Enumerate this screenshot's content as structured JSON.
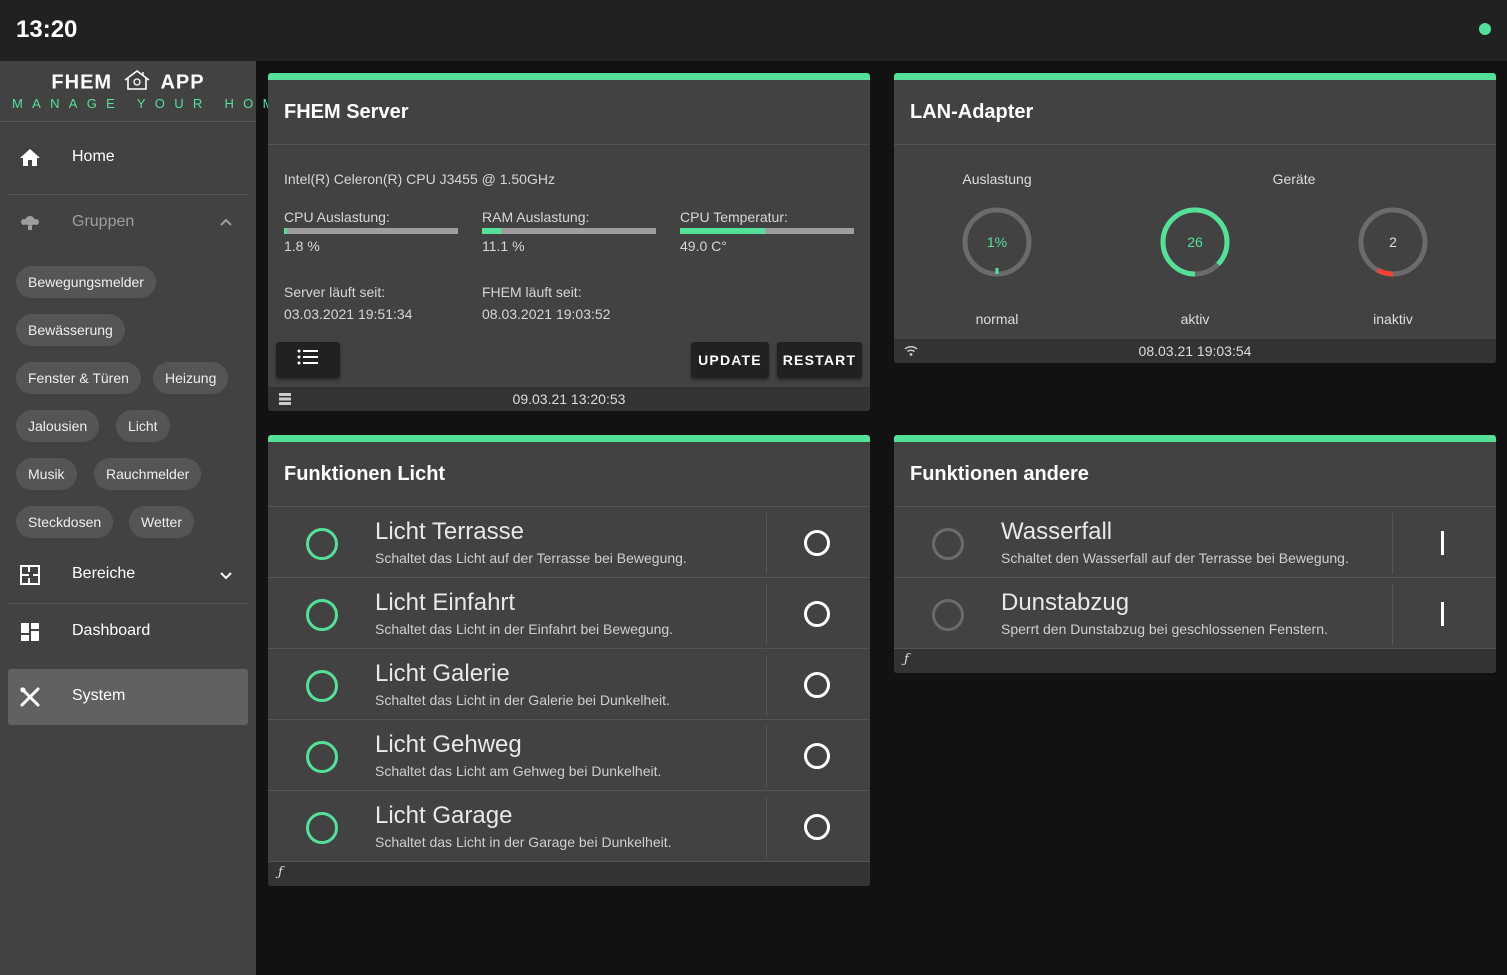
{
  "topbar": {
    "time": "13:20",
    "status_color": "#55e09a"
  },
  "brand": {
    "left": "FHEM",
    "right": "APP",
    "subtitle": "MANAGE YOUR HOME"
  },
  "nav": {
    "home": "Home",
    "gruppen": "Gruppen",
    "bereiche": "Bereiche",
    "dashboard": "Dashboard",
    "system": "System"
  },
  "chips": [
    "Bewegungsmelder",
    "Bewässerung",
    "Fenster & Türen",
    "Heizung",
    "Jalousien",
    "Licht",
    "Musik",
    "Rauchmelder",
    "Steckdosen",
    "Wetter"
  ],
  "server": {
    "title": "FHEM Server",
    "cpu_model": "Intel(R) Celeron(R) CPU J3455 @ 1.50GHz",
    "cpu_label": "CPU Auslastung:",
    "cpu_value": "1.8 %",
    "cpu_percent": 1.8,
    "ram_label": "RAM Auslastung:",
    "ram_value": "11.1 %",
    "ram_percent": 11.1,
    "temp_label": "CPU Temperatur:",
    "temp_value": "49.0 C°",
    "temp_percent": 49,
    "uptime_label": "Server läuft seit:",
    "uptime_value": "03.03.2021 19:51:34",
    "fhem_label": "FHEM läuft seit:",
    "fhem_value": "08.03.2021 19:03:52",
    "update_btn": "UPDATE",
    "restart_btn": "RESTART",
    "footer_time": "09.03.21 13:20:53"
  },
  "lan": {
    "title": "LAN-Adapter",
    "col1_label": "Auslastung",
    "col2_label": "Geräte",
    "gauge1_value": "1%",
    "gauge1_caption": "normal",
    "gauge2_value": "26",
    "gauge2_caption": "aktiv",
    "gauge3_value": "2",
    "gauge3_caption": "inaktiv",
    "footer_time": "08.03.21 19:03:54"
  },
  "licht": {
    "title": "Funktionen Licht",
    "footer_symbol": "ƒ",
    "items": [
      {
        "title": "Licht Terrasse",
        "desc": "Schaltet das Licht auf der Terrasse bei Bewegung."
      },
      {
        "title": "Licht Einfahrt",
        "desc": "Schaltet das Licht in der Einfahrt bei Bewegung."
      },
      {
        "title": "Licht Galerie",
        "desc": "Schaltet das Licht in der Galerie bei Dunkelheit."
      },
      {
        "title": "Licht Gehweg",
        "desc": "Schaltet das Licht am Gehweg bei Dunkelheit."
      },
      {
        "title": "Licht Garage",
        "desc": "Schaltet das Licht in der Garage bei Dunkelheit."
      }
    ]
  },
  "andere": {
    "title": "Funktionen andere",
    "footer_symbol": "ƒ",
    "items": [
      {
        "title": "Wasserfall",
        "desc": "Schaltet den Wasserfall auf der Terrasse bei Bewegung."
      },
      {
        "title": "Dunstabzug",
        "desc": "Sperrt den Dunstabzug bei geschlossenen Fenstern."
      }
    ]
  },
  "colors": {
    "accent": "#55e09a",
    "alert": "#f44336",
    "card": "#424242",
    "background": "#121212"
  }
}
